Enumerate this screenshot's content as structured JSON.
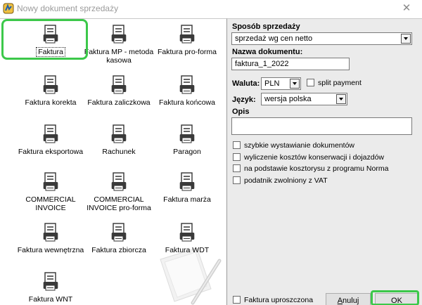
{
  "window": {
    "title": "Nowy dokument sprzedaży",
    "close_glyph": "✕"
  },
  "documents": [
    {
      "label": "Faktura",
      "selected": true
    },
    {
      "label": "Faktura MP - metoda kasowa",
      "selected": false
    },
    {
      "label": "Faktura pro-forma",
      "selected": false
    },
    {
      "label": "Faktura korekta",
      "selected": false
    },
    {
      "label": "Faktura zaliczkowa",
      "selected": false
    },
    {
      "label": "Faktura końcowa",
      "selected": false
    },
    {
      "label": "Faktura eksportowa",
      "selected": false
    },
    {
      "label": "Rachunek",
      "selected": false
    },
    {
      "label": "Paragon",
      "selected": false
    },
    {
      "label": "COMMERCIAL INVOICE",
      "selected": false
    },
    {
      "label": "COMMERCIAL INVOICE pro-forma",
      "selected": false
    },
    {
      "label": "Faktura marża",
      "selected": false
    },
    {
      "label": "Faktura wewnętrzna",
      "selected": false
    },
    {
      "label": "Faktura zbiorcza",
      "selected": false
    },
    {
      "label": "Faktura WDT",
      "selected": false
    },
    {
      "label": "Faktura WNT",
      "selected": false
    }
  ],
  "form": {
    "sale_method_label": "Sposób sprzedaży",
    "sale_method_value": "sprzedaż wg cen netto",
    "doc_name_label": "Nazwa dokumentu:",
    "doc_name_value": "faktura_1_2022",
    "currency_label": "Waluta:",
    "currency_value": "PLN",
    "split_payment_label": "split payment",
    "language_label": "Język:",
    "language_value": "wersja polska",
    "description_label": "Opis",
    "description_value": "",
    "options": [
      {
        "label": "szybkie wystawianie dokumentów",
        "checked": false
      },
      {
        "label": "wyliczenie kosztów konserwacji i dojazdów",
        "checked": false
      },
      {
        "label": "na podstawie kosztorysu z programu Norma",
        "checked": false
      },
      {
        "label": "podatnik zwolniony z VAT",
        "checked": false
      }
    ],
    "simplified_invoice_label": "Faktura uproszczona"
  },
  "buttons": {
    "cancel_label": "Anuluj",
    "ok_label": "OK"
  },
  "colors": {
    "highlight": "#3cc84a",
    "panel_bg": "#ebebeb",
    "icon_dark": "#3a3a3a"
  },
  "icons": {
    "document": "document-printer-icon",
    "app": "app-icon",
    "close": "close-icon"
  }
}
